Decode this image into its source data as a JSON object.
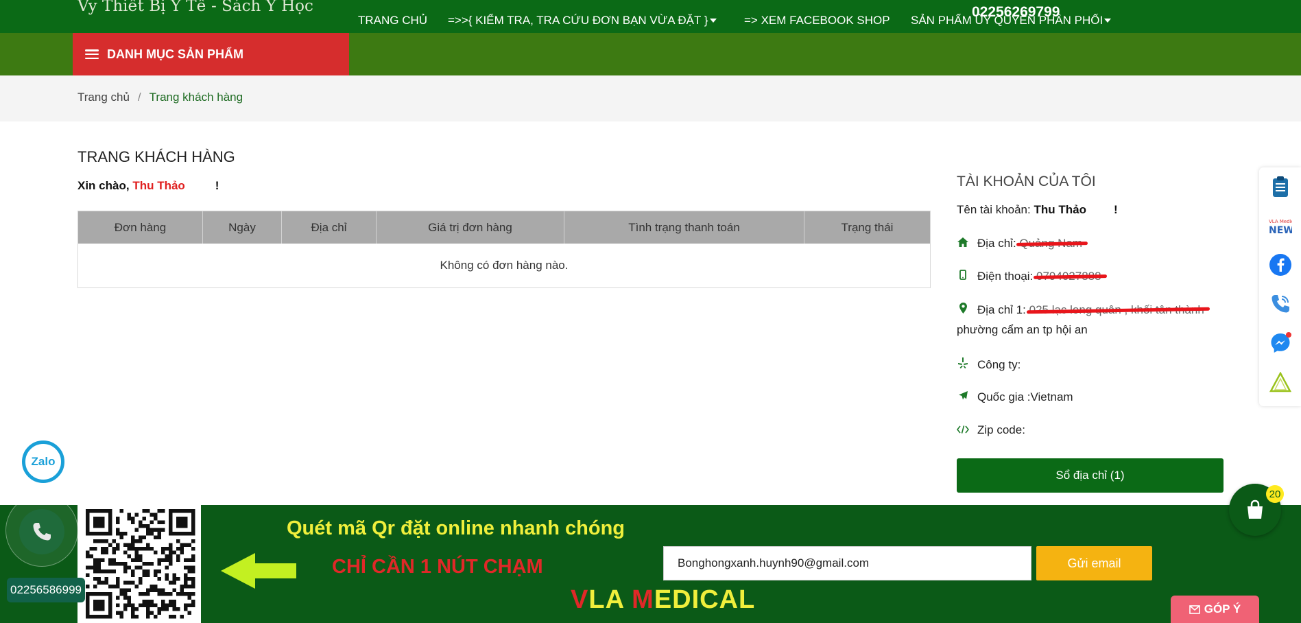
{
  "header": {
    "tagline": "Vy Thiết Bị Y Tế - Sách Y Học",
    "phone": "02256269799"
  },
  "nav": {
    "menu_label": "DANH MỤC SẢN PHẨM",
    "items": [
      {
        "label": "TRANG CHỦ"
      },
      {
        "label": "=>>{ KIỂM TRA, TRA CỨU ĐƠN BẠN VỪA ĐẶT }"
      },
      {
        "label": "=> XEM FACEBOOK SHOP"
      },
      {
        "label": "SẢN PHẨM ỦY QUYỀN PHÂN PHỐI"
      }
    ]
  },
  "breadcrumb": {
    "home": "Trang chủ",
    "separator": "/",
    "current": "Trang khách hàng"
  },
  "main": {
    "title": "TRANG KHÁCH HÀNG",
    "greeting_prefix": "Xin chào,",
    "user_name": "Thu Thảo",
    "greeting_suffix": "!",
    "orders": {
      "columns": [
        "Đơn hàng",
        "Ngày",
        "Địa chỉ",
        "Giá trị đơn hàng",
        "Tình trạng thanh toán",
        "Trạng thái"
      ],
      "empty_text": "Không có đơn hàng nào."
    }
  },
  "account": {
    "title": "TÀI KHOẢN CỦA TÔI",
    "username_label": "Tên tài khoản:",
    "username": "Thu Thảo",
    "username_suffix": "!",
    "address_label": "Địa chỉ:",
    "address_value": "Quảng Nam",
    "phone_label": "Điện thoại:",
    "phone_value": "0794027888",
    "address1_label": "Địa chỉ 1:",
    "address1_value": "025 lạc long quân , khối tân thành",
    "address1_cont": "phường cẩm an tp hội an",
    "company_label": "Công ty:",
    "country_label": "Quốc gia :",
    "country_value": "Vietnam",
    "zip_label": "Zip code:",
    "address_book_button": "Sổ địa chỉ (1)"
  },
  "footer": {
    "qr_text": "Quét mã Qr đặt online nhanh chóng",
    "one_touch": "CHỈ CẦN 1 NÚT CHẠM",
    "brand_v": "V",
    "brand_la": "LA ",
    "brand_m": "M",
    "brand_rest": "EDICAL",
    "email_value": "Bonghongxanh.huynh90@gmail.com",
    "send_button": "Gửi email"
  },
  "floating": {
    "zalo_label": "Zalo",
    "call_number": "02256586999",
    "cart_count": "20",
    "feedback_label": "GÓP Ý"
  },
  "colors": {
    "dark_green": "#0b6a16",
    "nav_green": "#3d7a12",
    "menu_red": "#d62d2d",
    "accent_red": "#e02020",
    "send_yellow": "#f5b311"
  }
}
